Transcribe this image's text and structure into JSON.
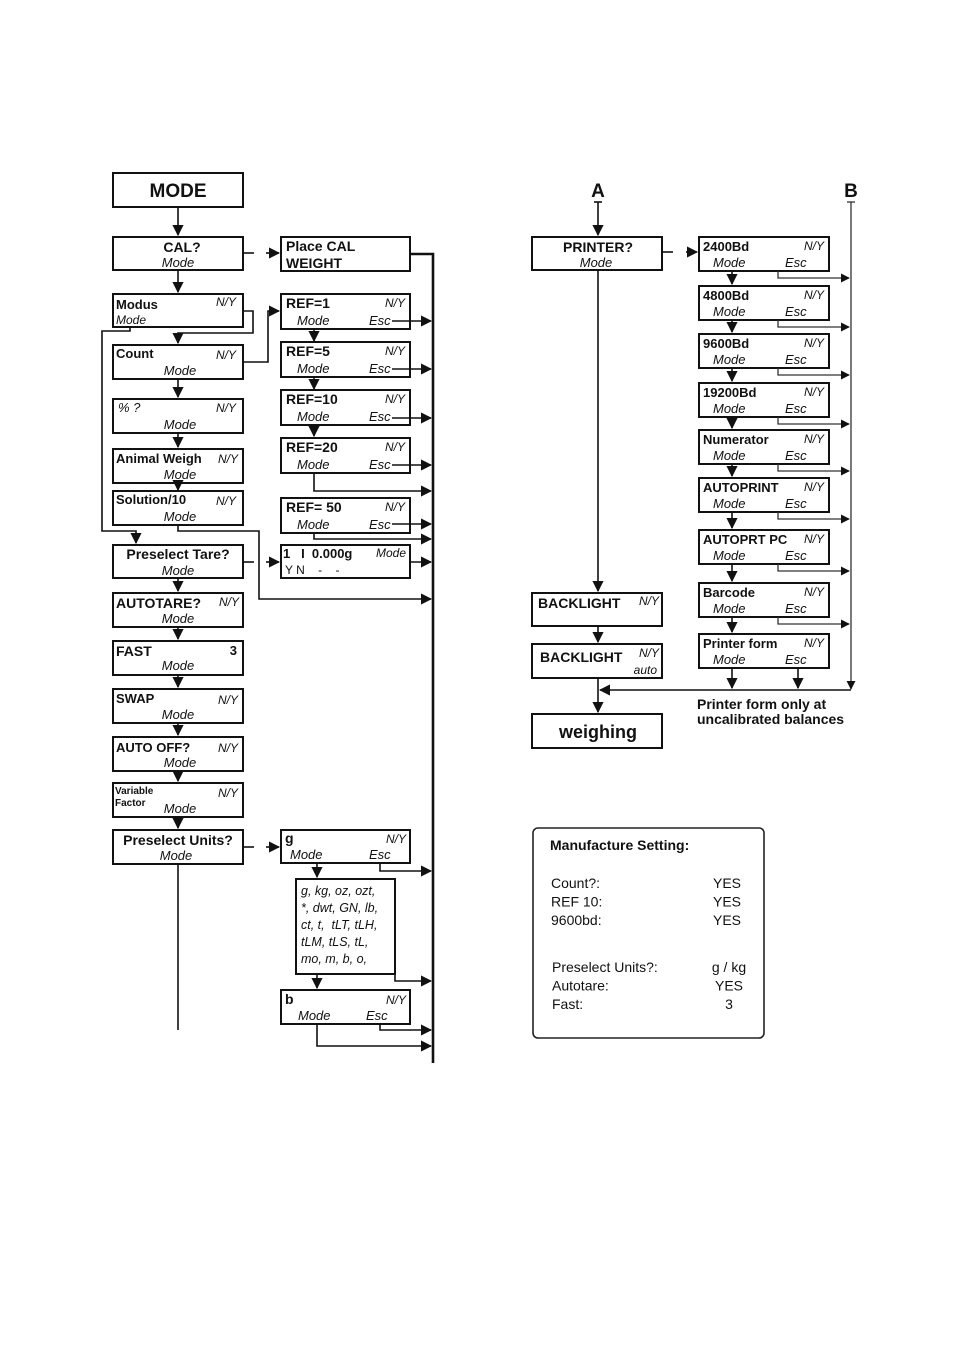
{
  "left": {
    "mode": "MODE",
    "cal": {
      "title": "CAL?",
      "sub": "Mode"
    },
    "place_cal": {
      "line1": "Place CAL",
      "line2": "WEIGHT"
    },
    "modus": {
      "title": "Modus",
      "opt": "N/Y",
      "sub": "Mode"
    },
    "count": {
      "title": "Count",
      "opt": "N/Y",
      "sub": "Mode"
    },
    "percent": {
      "title": "% ?",
      "opt": "N/Y",
      "sub": "Mode"
    },
    "animal": {
      "title": "Animal Weigh",
      "opt": "N/Y",
      "sub": "Mode"
    },
    "solution": {
      "title": "Solution/10",
      "opt": "N/Y",
      "sub": "Mode"
    },
    "preselect_tare": {
      "title": "Preselect Tare?",
      "sub": "Mode"
    },
    "autotare": {
      "title": "AUTOTARE?",
      "opt": "N/Y",
      "sub": "Mode"
    },
    "fast": {
      "title": "FAST",
      "opt": "3",
      "sub": "Mode"
    },
    "swap": {
      "title": "SWAP",
      "opt": "N/Y",
      "sub": "Mode"
    },
    "auto_off": {
      "title": "AUTO OFF?",
      "opt": "N/Y",
      "sub": "Mode"
    },
    "variable_factor": {
      "line1": "Variable",
      "line2": "Factor",
      "opt": "N/Y",
      "sub": "Mode"
    },
    "preselect_units": {
      "title": "Preselect Units?",
      "sub": "Mode"
    }
  },
  "refs": [
    {
      "title": "REF=1",
      "opt": "N/Y",
      "mode": "Mode",
      "esc": "Esc"
    },
    {
      "title": "REF=5",
      "opt": "N/Y",
      "mode": "Mode",
      "esc": "Esc"
    },
    {
      "title": "REF=10",
      "opt": "N/Y",
      "mode": "Mode",
      "esc": "Esc"
    },
    {
      "title": "REF=20",
      "opt": "N/Y",
      "mode": "Mode",
      "esc": "Esc"
    },
    {
      "title": "REF= 50",
      "opt": "N/Y",
      "mode": "Mode",
      "esc": "Esc"
    }
  ],
  "tare_display": {
    "line1": "1   I  0.000g",
    "mode": "Mode",
    "line2": "Y N    -    -"
  },
  "units": {
    "g": {
      "title": "g",
      "opt": "N/Y",
      "mode": "Mode",
      "esc": "Esc"
    },
    "list": [
      "g, kg, oz, ozt,",
      "*, dwt, GN, lb,",
      "ct, t,  tLT, tLH,",
      "tLM, tLS, tL,",
      "mo, m, b, o,"
    ],
    "b": {
      "title": "b",
      "opt": "N/Y",
      "mode": "Mode",
      "esc": "Esc"
    }
  },
  "right": {
    "label_a": "A",
    "label_b": "B",
    "printer": {
      "title": "PRINTER?",
      "sub": "Mode"
    },
    "backlight1": {
      "title": "BACKLIGHT",
      "opt": "N/Y"
    },
    "backlight2": {
      "title": "BACKLIGHT",
      "opt": "N/Y",
      "sub": "auto"
    },
    "weighing": "weighing",
    "note_line1": "Printer form only at",
    "note_line2": "uncalibrated balances"
  },
  "printer_options": [
    {
      "title": "2400Bd",
      "opt": "N/Y",
      "mode": "Mode",
      "esc": "Esc"
    },
    {
      "title": "4800Bd",
      "opt": "N/Y",
      "mode": "Mode",
      "esc": "Esc"
    },
    {
      "title": "9600Bd",
      "opt": "N/Y",
      "mode": "Mode",
      "esc": "Esc"
    },
    {
      "title": "19200Bd",
      "opt": "N/Y",
      "mode": "Mode",
      "esc": "Esc"
    },
    {
      "title": "Numerator",
      "opt": "N/Y",
      "mode": "Mode",
      "esc": "Esc"
    },
    {
      "title": "AUTOPRINT",
      "opt": "N/Y",
      "mode": "Mode",
      "esc": "Esc"
    },
    {
      "title": "AUTOPRT PC",
      "opt": "N/Y",
      "mode": "Mode",
      "esc": "Esc"
    },
    {
      "title": "Barcode",
      "opt": "N/Y",
      "mode": "Mode",
      "esc": "Esc"
    },
    {
      "title": "Printer form",
      "opt": "N/Y",
      "mode": "Mode",
      "esc": "Esc"
    }
  ],
  "manufacture": {
    "title": "Manufacture Setting:",
    "group1": [
      {
        "label": "Count?:",
        "value": "YES"
      },
      {
        "label": "REF 10:",
        "value": "YES"
      },
      {
        "label": "9600bd:",
        "value": "YES"
      }
    ],
    "group2": [
      {
        "label": "Preselect Units?:",
        "value": "g / kg"
      },
      {
        "label": "Autotare:",
        "value": "YES"
      },
      {
        "label": "Fast:",
        "value": "3"
      }
    ]
  }
}
